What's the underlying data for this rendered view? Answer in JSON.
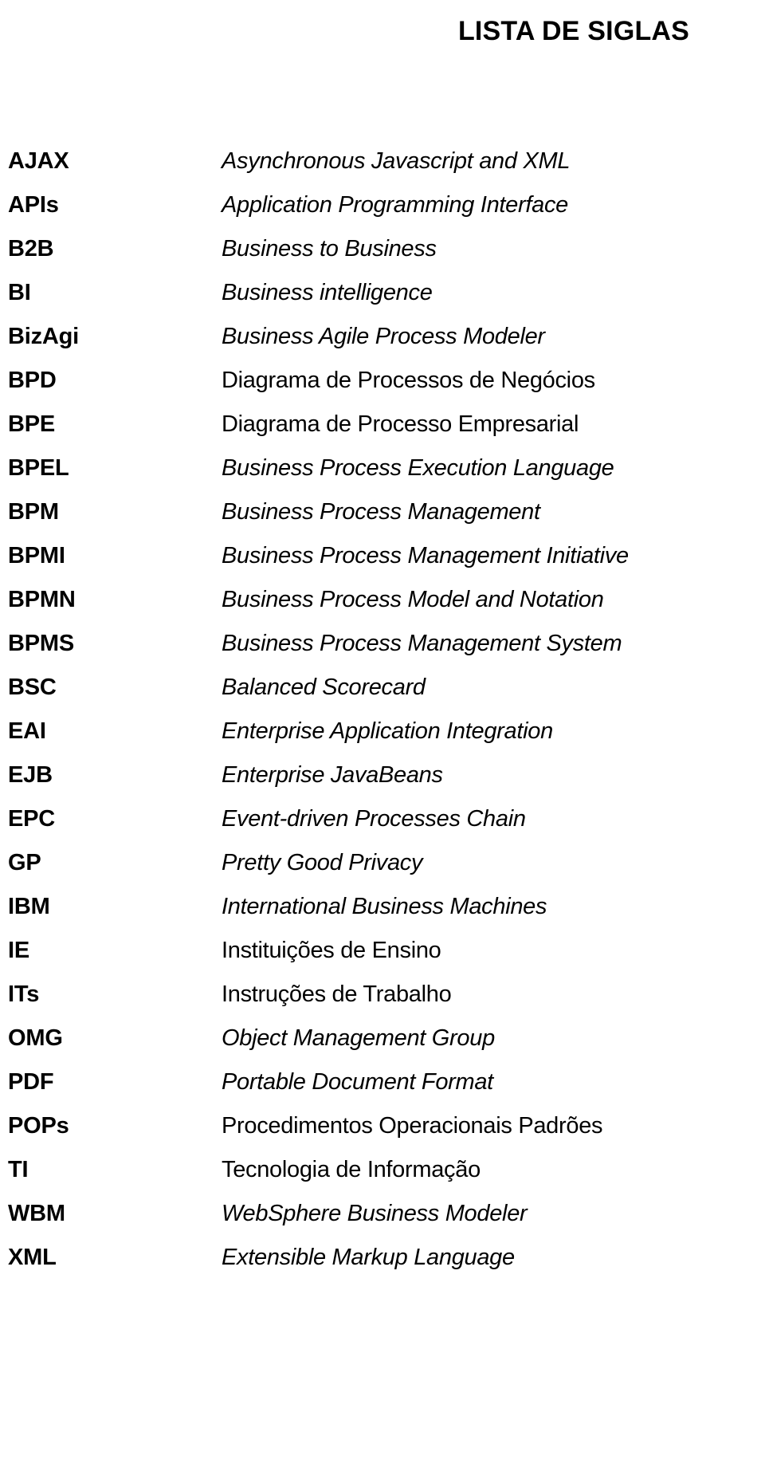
{
  "page": {
    "title": "LISTA DE SIGLAS",
    "background_color": "#ffffff",
    "text_color": "#000000"
  },
  "siglas": [
    {
      "term": "AJAX",
      "definition": "Asynchronous Javascript and XML",
      "style": "italic"
    },
    {
      "term": "APIs",
      "definition": "Application Programming Interface",
      "style": "italic"
    },
    {
      "term": "B2B",
      "definition": "Business to Business",
      "style": "italic"
    },
    {
      "term": "BI",
      "definition": "Business intelligence",
      "style": "italic"
    },
    {
      "term": "BizAgi",
      "definition": "Business Agile Process Modeler",
      "style": "italic"
    },
    {
      "term": "BPD",
      "definition": "Diagrama de Processos de Negócios",
      "style": "roman"
    },
    {
      "term": "BPE",
      "definition": "Diagrama de Processo Empresarial",
      "style": "roman"
    },
    {
      "term": "BPEL",
      "definition": "Business Process Execution Language",
      "style": "italic"
    },
    {
      "term": "BPM",
      "definition": "Business Process Management",
      "style": "italic"
    },
    {
      "term": "BPMI",
      "definition": "Business Process Management Initiative",
      "style": "italic"
    },
    {
      "term": "BPMN",
      "definition": "Business Process Model and Notation",
      "style": "italic"
    },
    {
      "term": "BPMS",
      "definition": "Business Process Management System",
      "style": "italic"
    },
    {
      "term": "BSC",
      "definition": "Balanced Scorecard",
      "style": "italic"
    },
    {
      "term": "EAI",
      "definition": "Enterprise Application Integration",
      "style": "italic"
    },
    {
      "term": "EJB",
      "definition": "Enterprise JavaBeans",
      "style": "italic"
    },
    {
      "term": "EPC",
      "definition": "Event-driven Processes Chain",
      "style": "italic"
    },
    {
      "term": "GP",
      "definition": "Pretty Good Privacy",
      "style": "italic"
    },
    {
      "term": "IBM",
      "definition": "International Business Machines",
      "style": "italic"
    },
    {
      "term": "IE",
      "definition": "Instituições de Ensino",
      "style": "roman"
    },
    {
      "term": "ITs",
      "definition": "Instruções de Trabalho",
      "style": "roman"
    },
    {
      "term": "OMG",
      "definition": "Object Management Group",
      "style": "italic"
    },
    {
      "term": "PDF",
      "definition": "Portable Document Format",
      "style": "italic"
    },
    {
      "term": "POPs",
      "definition": "Procedimentos Operacionais Padrões",
      "style": "roman"
    },
    {
      "term": "TI",
      "definition": "Tecnologia de Informação",
      "style": "roman"
    },
    {
      "term": "WBM",
      "definition": "WebSphere Business Modeler",
      "style": "italic"
    },
    {
      "term": "XML",
      "definition": "Extensible Markup Language",
      "style": "italic"
    }
  ]
}
